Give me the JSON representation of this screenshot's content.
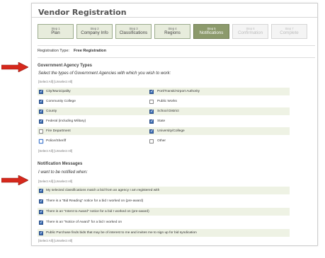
{
  "page": {
    "title": "Vendor Registration"
  },
  "steps": [
    {
      "num": "Step 1",
      "label": "Plan",
      "state": "done"
    },
    {
      "num": "Step 2",
      "label": "Company Info",
      "state": "done"
    },
    {
      "num": "Step 3",
      "label": "Classifications",
      "state": "done"
    },
    {
      "num": "Step 4",
      "label": "Regions",
      "state": "done"
    },
    {
      "num": "Step 5",
      "label": "Notifications",
      "state": "active"
    },
    {
      "num": "Step 6",
      "label": "Confirmation",
      "state": "disabled"
    },
    {
      "num": "Step 7",
      "label": "Complete",
      "state": "disabled"
    }
  ],
  "registration": {
    "label": "Registration Type:",
    "value": "Free Registration"
  },
  "agencies": {
    "heading": "Government Agency Types",
    "prompt": "Select the types of Government Agencies with which you wish to work:",
    "select_top": "[Select All] [Unselect All]",
    "select_bottom": "[Select All] [Unselect All]",
    "left": [
      {
        "label": "City/Municipality",
        "checked": true
      },
      {
        "label": "Community College",
        "checked": true
      },
      {
        "label": "County",
        "checked": true
      },
      {
        "label": "Federal (including Military)",
        "checked": true
      },
      {
        "label": "Fire Department",
        "checked": false
      },
      {
        "label": "Police/Sheriff",
        "checked": false
      }
    ],
    "right": [
      {
        "label": "Port/Transit/Airport Authority",
        "checked": true
      },
      {
        "label": "Public Works",
        "checked": false
      },
      {
        "label": "School District",
        "checked": true
      },
      {
        "label": "State",
        "checked": true
      },
      {
        "label": "University/College",
        "checked": true
      },
      {
        "label": "Other",
        "checked": false
      }
    ]
  },
  "notifications": {
    "heading": "Notification Messages",
    "prompt": "I want to be notified when:",
    "select_top": "[Select All] [Unselect All]",
    "select_bottom": "[Select All] [Unselect All]",
    "items": [
      {
        "label": "My selected classifications match a bid from an agency I am registered with",
        "checked": true
      },
      {
        "label": "There is a \"Bid Reading\" notice for a bid I worked on (pre-award)",
        "checked": true
      },
      {
        "label": "There is an \"Intent to Award\" notice for a bid I worked on (pre-award)",
        "checked": true
      },
      {
        "label": "There is an \"Notice of Award\" for a bid I worked on",
        "checked": true
      },
      {
        "label": "Public Purchase finds bids that may be of interest to me and invites me to sign up for bid syndication",
        "checked": true
      }
    ]
  },
  "colors": {
    "arrow": "#d6281c",
    "active_step": "#8c9a6c",
    "checkbox": "#3d6fb6"
  }
}
